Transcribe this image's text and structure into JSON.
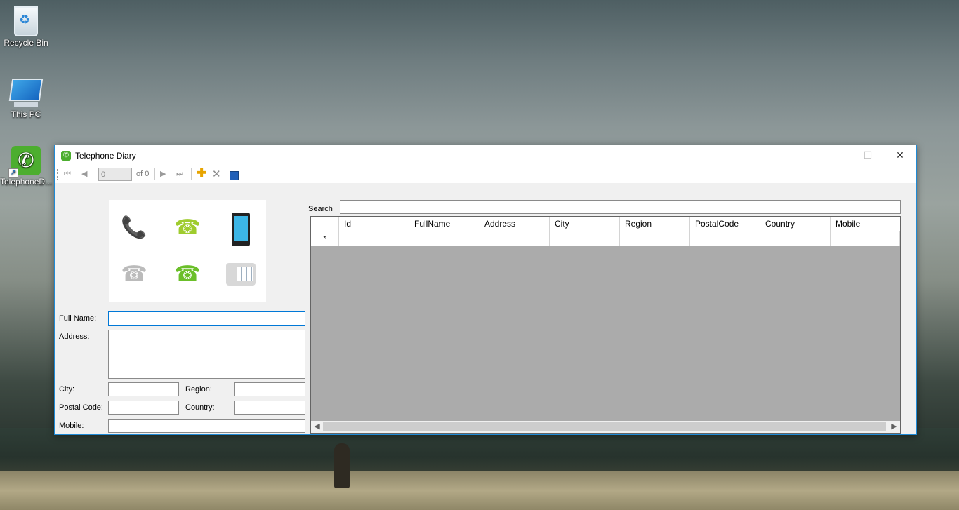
{
  "desktop": {
    "icons": [
      {
        "label": "Recycle Bin"
      },
      {
        "label": "This PC"
      },
      {
        "label": "TelephoneD..."
      }
    ]
  },
  "window": {
    "title": "Telephone Diary",
    "controls": {
      "minimize": "—",
      "maximize": "☐",
      "close": "✕"
    }
  },
  "navigator": {
    "position_value": "0",
    "count_label": "of 0"
  },
  "form": {
    "full_name_label": "Full Name:",
    "full_name_value": "",
    "address_label": "Address:",
    "address_value": "",
    "city_label": "City:",
    "city_value": "",
    "region_label": "Region:",
    "region_value": "",
    "postal_code_label": "Postal Code:",
    "postal_code_value": "",
    "country_label": "Country:",
    "country_value": "",
    "mobile_label": "Mobile:",
    "mobile_value": ""
  },
  "search": {
    "label": "Search",
    "value": ""
  },
  "grid": {
    "columns": [
      "Id",
      "FullName",
      "Address",
      "City",
      "Region",
      "PostalCode",
      "Country",
      "Mobile"
    ],
    "new_row_marker": "*"
  },
  "colors": {
    "accent": "#0078d7",
    "app_icon": "#4cae2f",
    "grid_background": "#ababab"
  }
}
